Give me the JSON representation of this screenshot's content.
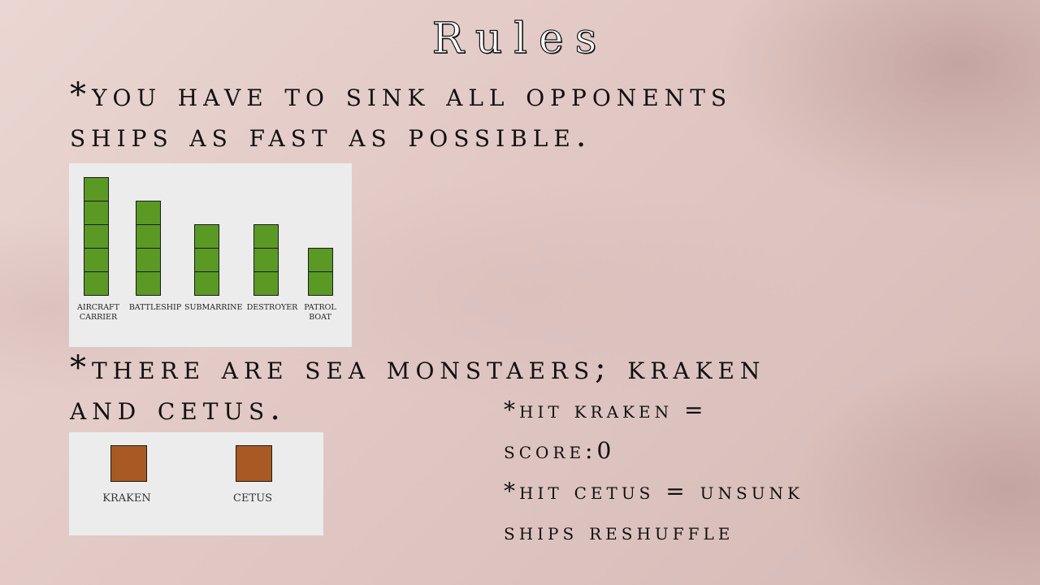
{
  "slide": {
    "title": "Rules",
    "rule1_line1": "*You have to sink all opponents",
    "rule1_line2": "ships as fast as possible.",
    "rule2_line1": "*There are sea monstaers; Kraken",
    "rule2_line2": "and Cetus.",
    "hit_kraken_line1": "*Hit Kraken =",
    "hit_kraken_line2": "score:0",
    "hit_cetus_line1": "*Hit Cetus = Unsunk",
    "hit_cetus_line2": "ships reshuffle"
  },
  "ships": [
    {
      "label_line1": "AIRCRAFT",
      "label_line2": "CARRIER",
      "cells": 5
    },
    {
      "label_line1": "BATTLESHIP",
      "label_line2": "",
      "cells": 4
    },
    {
      "label_line1": "SUBMARRINE",
      "label_line2": "",
      "cells": 3
    },
    {
      "label_line1": "DESTROYER",
      "label_line2": "",
      "cells": 3
    },
    {
      "label_line1": "PATROL",
      "label_line2": "BOAT",
      "cells": 2
    }
  ],
  "monsters": [
    {
      "label": "KRAKEN"
    },
    {
      "label": "CETUS"
    }
  ],
  "colors": {
    "ship_fill": "#5a9a24",
    "monster_fill": "#a85a22",
    "panel_bg": "#ececec",
    "background": "#e2c9c5"
  }
}
